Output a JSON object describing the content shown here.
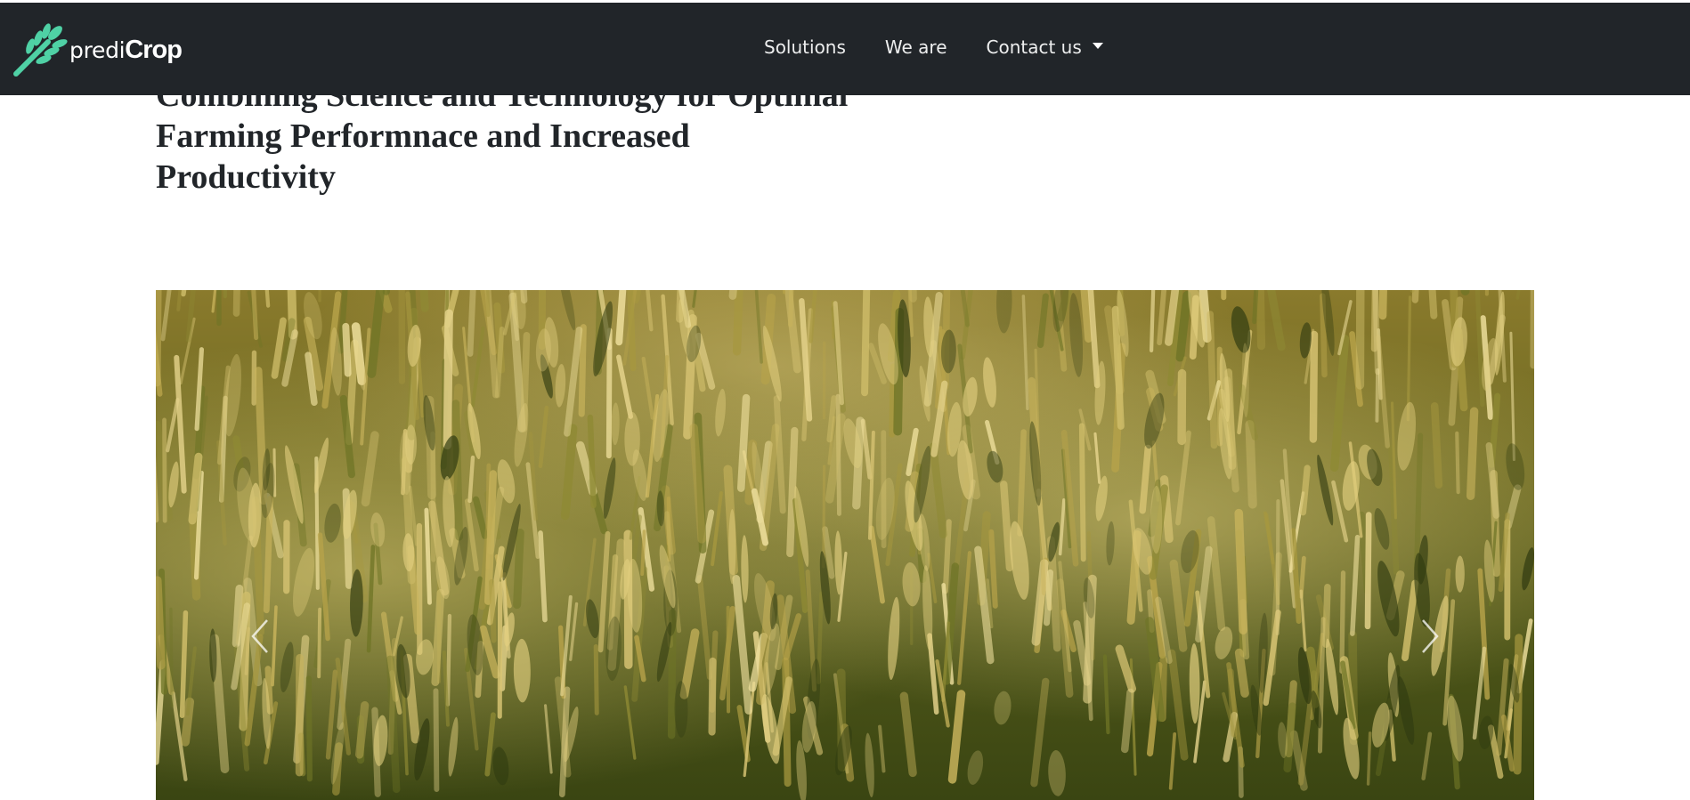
{
  "brand": {
    "name_light": "predi",
    "name_bold": "Crop",
    "logo_icon": "wheat-leaf-icon",
    "accent_color": "#4fd1a5"
  },
  "nav": {
    "items": [
      {
        "label": "Solutions"
      },
      {
        "label": "We are"
      },
      {
        "label": "Contact us",
        "has_dropdown": true
      }
    ]
  },
  "hero": {
    "headline_lines": [
      "Combining Science and Technology for Optimal",
      "Farming Performnace and Increased",
      "Productivity"
    ]
  },
  "carousel": {
    "image": "wheat-field-photo",
    "prev_icon": "chevron-left-icon",
    "next_icon": "chevron-right-icon"
  },
  "colors": {
    "navbar_bg": "#212529",
    "text": "#212529"
  }
}
